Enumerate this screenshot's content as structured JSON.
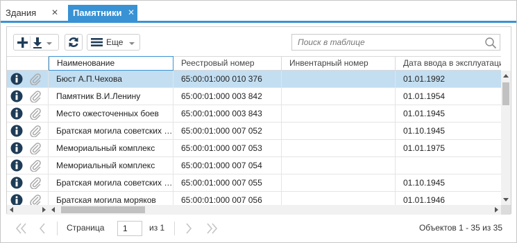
{
  "tabs": [
    {
      "label": "Здания",
      "active": false
    },
    {
      "label": "Памятники",
      "active": true
    }
  ],
  "toolbar": {
    "add_icon": "plus-icon",
    "export_icon": "download-icon",
    "refresh_icon": "refresh-icon",
    "more_label": "Еще",
    "search_placeholder": "Поиск в таблице"
  },
  "table": {
    "columns": [
      "Наименование",
      "Реестровый номер",
      "Инвентарный номер",
      "Дата ввода в эксплуатацию"
    ],
    "rows": [
      {
        "name": "Бюст А.П.Чехова",
        "reg": "65:00:01:000 010 376",
        "inv": "",
        "date": "01.01.1992",
        "selected": true
      },
      {
        "name": "Памятник В.И.Ленину",
        "reg": "65:00:01:000 003 842",
        "inv": "",
        "date": "01.01.1954"
      },
      {
        "name": "Место ожесточенных боев",
        "reg": "65:00:01:000 003 843",
        "inv": "",
        "date": "01.01.1945"
      },
      {
        "name": "Братская могила советских воинов",
        "reg": "65:00:01:000 007 052",
        "inv": "",
        "date": "01.10.1945"
      },
      {
        "name": "Мемориальный комплекс",
        "reg": "65:00:01:000 007 053",
        "inv": "",
        "date": "01.01.1975"
      },
      {
        "name": "Мемориальный комплекс",
        "reg": "65:00:01:000 007 054",
        "inv": "",
        "date": ""
      },
      {
        "name": "Братская могила советских воинов",
        "reg": "65:00:01:000 007 055",
        "inv": "",
        "date": "01.10.1945"
      },
      {
        "name": "Братская могила моряков",
        "reg": "65:00:01:000 007 056",
        "inv": "",
        "date": "01.01.1946"
      }
    ]
  },
  "pager": {
    "page_label": "Страница",
    "page_value": "1",
    "of_label": "из 1",
    "count_label": "Объектов 1 - 35 из 35"
  },
  "colors": {
    "accent": "#3892d4",
    "selected_row": "#c3def1",
    "icon_dark": "#1e3c57"
  }
}
